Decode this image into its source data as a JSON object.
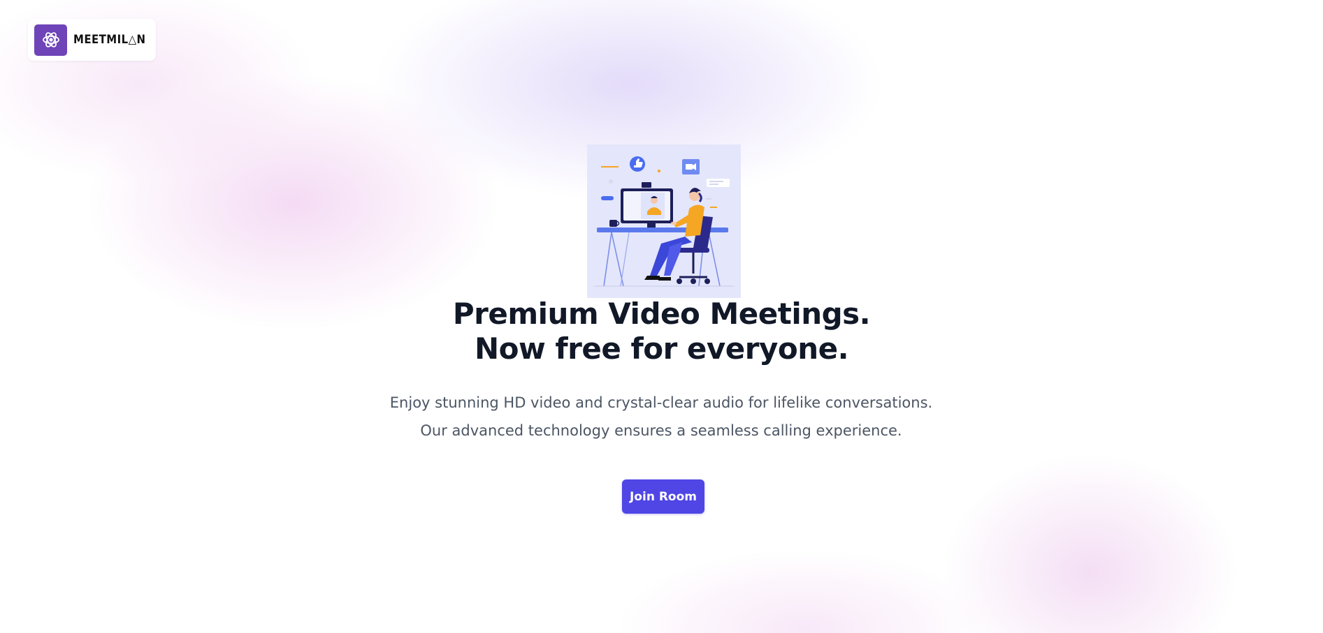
{
  "brand": {
    "logo_text": "MEETMIL△N",
    "logo_color": "#6e44b8"
  },
  "hero": {
    "illustration": "video-call-person-at-desk-illustration",
    "headline_line1": "Premium Video Meetings.",
    "headline_line2": "Now free for everyone.",
    "subtitle": "Enjoy stunning HD video and crystal-clear audio for lifelike conversations. Our advanced technology ensures a seamless calling experience."
  },
  "cta": {
    "join_label": "Join Room",
    "color": "#4f46e5"
  }
}
